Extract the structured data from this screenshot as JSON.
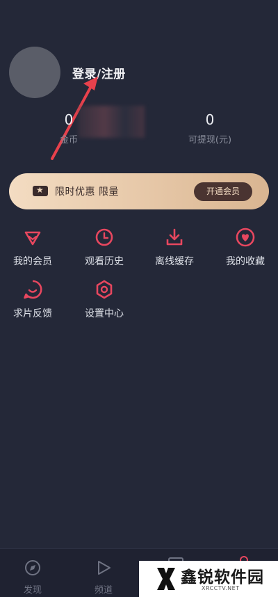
{
  "profile": {
    "login_label": "登录/注册"
  },
  "stats": {
    "coins_value": "0",
    "coins_label": "金币",
    "cash_value": "0",
    "cash_label": "可提现(元)"
  },
  "vip": {
    "promo_text": "限时优惠 限量",
    "button_label": "开通会员"
  },
  "menu": {
    "items": [
      {
        "label": "我的会员",
        "icon": "diamond-icon"
      },
      {
        "label": "观看历史",
        "icon": "clock-icon"
      },
      {
        "label": "离线缓存",
        "icon": "download-icon"
      },
      {
        "label": "我的收藏",
        "icon": "heart-icon"
      },
      {
        "label": "求片反馈",
        "icon": "feedback-icon"
      },
      {
        "label": "设置中心",
        "icon": "gear-icon"
      }
    ]
  },
  "tabbar": {
    "tabs": [
      {
        "label": "发现",
        "icon": "compass-icon"
      },
      {
        "label": "频道",
        "icon": "play-icon"
      }
    ]
  },
  "watermark": {
    "title": "鑫锐软件园",
    "subtitle": "XRCCTV.NET"
  },
  "colors": {
    "background": "#242838",
    "accent": "#e8475f",
    "arrow": "#e8414c",
    "vip_gold": "#e6c7a7"
  }
}
